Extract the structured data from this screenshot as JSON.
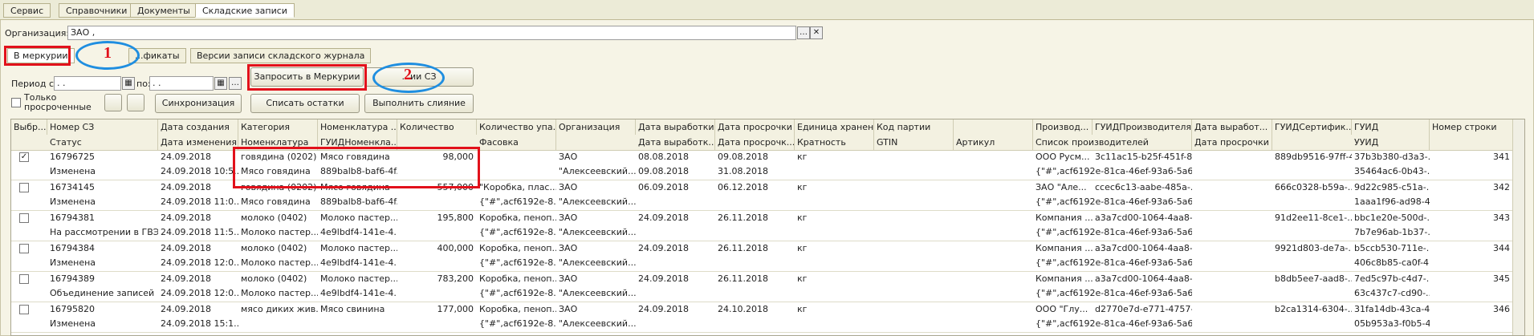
{
  "top_tabs": [
    "Сервис",
    "Справочники",
    "Документы",
    "Складские записи"
  ],
  "organization": {
    "label": "Организация:",
    "value": "ЗАО                                        ,"
  },
  "sub_tabs": [
    "В меркурии",
    "...фикаты",
    "Версии записи складского журнала"
  ],
  "period": {
    "label_from": "Период с:",
    "from": ". .",
    "label_to": "по:",
    "to": ". ."
  },
  "only_expired": "Только просроченные",
  "buttons": {
    "request": "Запросить в Меркурии",
    "versions": "...ии СЗ",
    "sync": "Синхронизация",
    "writeoff": "Списать остатки",
    "merge": "Выполнить слияние"
  },
  "annotations": {
    "n1": "1",
    "n2": "2"
  },
  "columns_row1": [
    "Выбр...",
    "Номер СЗ",
    "Дата создания",
    "Категория",
    "Номенклатура ...",
    "Количество",
    "Количество упа...",
    "Организация",
    "Дата выработки",
    "Дата просрочки",
    "Единица хранен...",
    "Код партии",
    "",
    "Производ...",
    "ГУИДПроизводителя",
    "Дата выработ...",
    "ГУИДСертифик...",
    "ГУИД",
    "Номер строки"
  ],
  "columns_row2": [
    "",
    "Статус",
    "Дата изменения",
    "Номенклатура",
    "ГУИДНоменкла...",
    "",
    "Фасовка",
    "",
    "Дата выработк...",
    "Дата просрочк...",
    "Кратность",
    "GTIN",
    "Артикул",
    "Список производителей",
    "",
    "Дата просрочки",
    "",
    "УУИД",
    ""
  ],
  "rows": [
    {
      "checked": true,
      "a": [
        "16796725",
        "24.09.2018",
        "говядина (0202)",
        "Мясо говядина",
        "98,000",
        "",
        "ЗАО",
        "08.08.2018",
        "09.08.2018",
        "кг",
        "",
        "",
        "ООО Русм...",
        "3c11ac15-b25f-451f-8...",
        "",
        "889db9516-97ff-4...",
        "37b3b380-d3a3-...",
        "341"
      ],
      "b": [
        "Изменена",
        "24.09.2018 10:5...",
        "Мясо говядина",
        "889balb8-baf6-4f...",
        "",
        "",
        "\"Алексеевский...",
        "09.08.2018",
        "31.08.2018",
        "",
        "",
        "",
        "{\"#\",acf6192e-81ca-46ef-93a6-5a696...",
        "",
        "",
        "",
        "35464ac6-0b43-...",
        ""
      ]
    },
    {
      "checked": false,
      "a": [
        "16734145",
        "24.09.2018",
        "говядина (0202)",
        "Мясо говядина",
        "557,000",
        "\"Коробка, плас...",
        "ЗАО",
        "06.09.2018",
        "06.12.2018",
        "кг",
        "",
        "",
        "ЗАО \"Але...",
        "ccec6c13-aabe-485a-...",
        "",
        "666c0328-b59a-...",
        "9d22c985-c51a-...",
        "342"
      ],
      "b": [
        "Изменена",
        "24.09.2018 11:0...",
        "Мясо говядина",
        "889balb8-baf6-4f...",
        "",
        "{\"#\",acf6192e-8...",
        "\"Алексеевский...",
        "",
        "",
        "",
        "",
        "",
        "{\"#\",acf6192e-81ca-46ef-93a6-5a696...",
        "",
        "",
        "",
        "1aaa1f96-ad98-4...",
        ""
      ]
    },
    {
      "checked": false,
      "a": [
        "16794381",
        "24.09.2018",
        "молоко (0402)",
        "Молоко пастер...",
        "195,800",
        "Коробка, пеноп...",
        "ЗАО",
        "24.09.2018",
        "26.11.2018",
        "кг",
        "",
        "",
        "Компания ...",
        "a3a7cd00-1064-4aa8-...",
        "",
        "91d2ee11-8ce1-...",
        "bbc1e20e-500d-...",
        "343"
      ],
      "b": [
        "На рассмотрении в ГВЭ",
        "24.09.2018 11:5...",
        "Молоко пастер...",
        "4e9lbdf4-141e-4...",
        "",
        "{\"#\",acf6192e-8...",
        "\"Алексеевский...",
        "",
        "",
        "",
        "",
        "",
        "{\"#\",acf6192e-81ca-46ef-93a6-5a696...",
        "",
        "",
        "",
        "7b7e96ab-1b37-...",
        ""
      ]
    },
    {
      "checked": false,
      "a": [
        "16794384",
        "24.09.2018",
        "молоко (0402)",
        "Молоко пастер...",
        "400,000",
        "Коробка, пеноп...",
        "ЗАО",
        "24.09.2018",
        "26.11.2018",
        "кг",
        "",
        "",
        "Компания ...",
        "a3a7cd00-1064-4aa8-...",
        "",
        "9921d803-de7a-...",
        "b5ccb530-711e-...",
        "344"
      ],
      "b": [
        "Изменена",
        "24.09.2018 12:0...",
        "Молоко пастер...",
        "4e9lbdf4-141e-4...",
        "",
        "{\"#\",acf6192e-8...",
        "\"Алексеевский...",
        "",
        "",
        "",
        "",
        "",
        "{\"#\",acf6192e-81ca-46ef-93a6-5a696...",
        "",
        "",
        "",
        "406c8b85-ca0f-4...",
        ""
      ]
    },
    {
      "checked": false,
      "a": [
        "16794389",
        "24.09.2018",
        "молоко (0402)",
        "Молоко пастер...",
        "783,200",
        "Коробка, пеноп...",
        "ЗАО",
        "24.09.2018",
        "26.11.2018",
        "кг",
        "",
        "",
        "Компания ...",
        "a3a7cd00-1064-4aa8-...",
        "",
        "b8db5ee7-aad8-...",
        "7ed5c97b-c4d7-...",
        "345"
      ],
      "b": [
        "Объединение записей",
        "24.09.2018 12:0...",
        "Молоко пастер...",
        "4e9lbdf4-141e-4...",
        "",
        "{\"#\",acf6192e-8...",
        "\"Алексеевский...",
        "",
        "",
        "",
        "",
        "",
        "{\"#\",acf6192e-81ca-46ef-93a6-5a696...",
        "",
        "",
        "",
        "63c437c7-cd90-...",
        ""
      ]
    },
    {
      "checked": false,
      "a": [
        "16795820",
        "24.09.2018",
        "мясо диких жив...",
        "Мясо свинина",
        "177,000",
        "Коробка, пеноп...",
        "ЗАО",
        "24.09.2018",
        "24.10.2018",
        "кг",
        "",
        "",
        "ООО \"Глу...",
        "d2770e7d-e771-4757-...",
        "",
        "b2ca1314-6304-...",
        "31fa14db-43ca-4...",
        "346"
      ],
      "b": [
        "Изменена",
        "24.09.2018 15:1...",
        "",
        "",
        "",
        "{\"#\",acf6192e-8...",
        "\"Алексеевский...",
        "",
        "",
        "",
        "",
        "",
        "{\"#\",acf6192e-81ca-46ef-93a6-5a696...",
        "",
        "",
        "",
        "05b953a3-f0b5-4...",
        ""
      ]
    }
  ]
}
